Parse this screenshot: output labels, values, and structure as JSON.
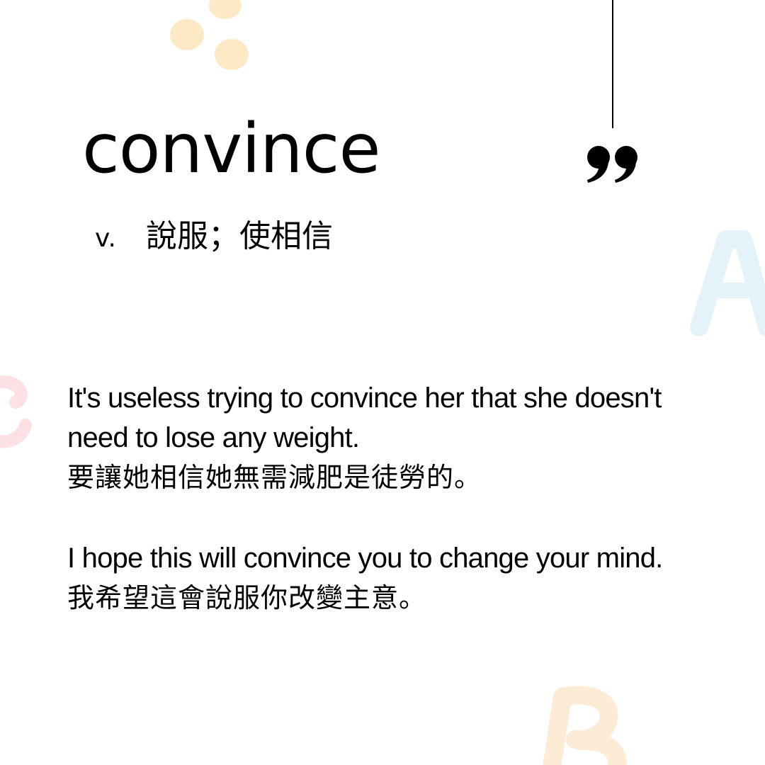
{
  "colors": {
    "background": "#ffffff",
    "text": "#000000",
    "dots": "#fde9c6",
    "letter_a": "#e4f3fa",
    "letter_c": "#fde0e3",
    "letter_b": "#fdebd6"
  },
  "decorations": {
    "letters": [
      "A",
      "C",
      "B"
    ],
    "quote_mark": "”"
  },
  "word": "convince",
  "definition": {
    "part_of_speech": "v.",
    "meaning": "說服；使相信"
  },
  "examples": [
    {
      "en": "It's useless trying to convince her that she doesn't need to lose any weight.",
      "zh": "要讓她相信她無需減肥是徒勞的。"
    },
    {
      "en": "I hope this will convince you to change your mind.",
      "zh": "我希望這會說服你改變主意。"
    }
  ]
}
